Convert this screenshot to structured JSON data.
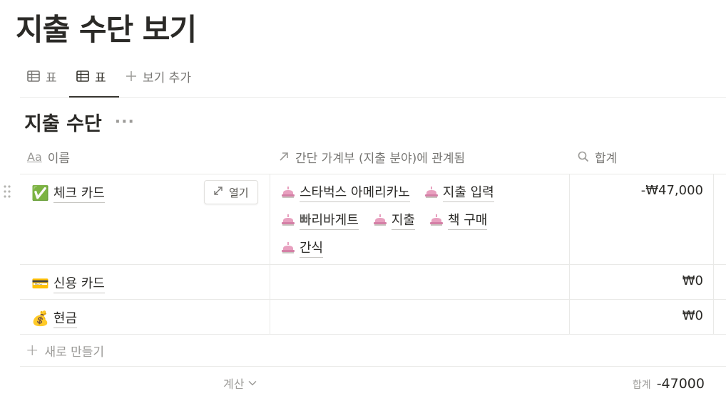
{
  "page": {
    "title": "지출 수단 보기"
  },
  "tabs": [
    {
      "label": "표",
      "icon": "table-icon"
    },
    {
      "label": "표",
      "icon": "table-icon",
      "active": true
    },
    {
      "label": "보기 추가",
      "icon": "plus-icon"
    }
  ],
  "database": {
    "title": "지출 수단",
    "more": "···"
  },
  "columns": {
    "name": {
      "icon_text": "Aa",
      "label": "이름"
    },
    "relation": {
      "icon": "arrow-up-right-icon",
      "label": "간단 가계부 (지출 분야)에 관계됨"
    },
    "total": {
      "icon": "search-icon",
      "label": "합계"
    }
  },
  "rows": [
    {
      "emoji": "✅",
      "name": "체크 카드",
      "open_label": "열기",
      "relations": [
        "스타벅스 아메리카노",
        "지출 입력",
        "빠리바게트",
        "지출",
        "책 구매",
        "간식"
      ],
      "amount": "-₩47,000"
    },
    {
      "emoji": "💳",
      "name": "신용 카드",
      "relations": [],
      "amount": "₩0"
    },
    {
      "emoji": "💰",
      "name": "현금",
      "relations": [],
      "amount": "₩0"
    }
  ],
  "new_row_label": "새로 만들기",
  "footer": {
    "calc_label": "계산",
    "sum_label": "합계",
    "sum_value": "-47000"
  },
  "colors": {
    "text": "#37352f",
    "muted": "#9b9a97",
    "border": "#e9e9e7",
    "cake": "#e8a0bf"
  }
}
